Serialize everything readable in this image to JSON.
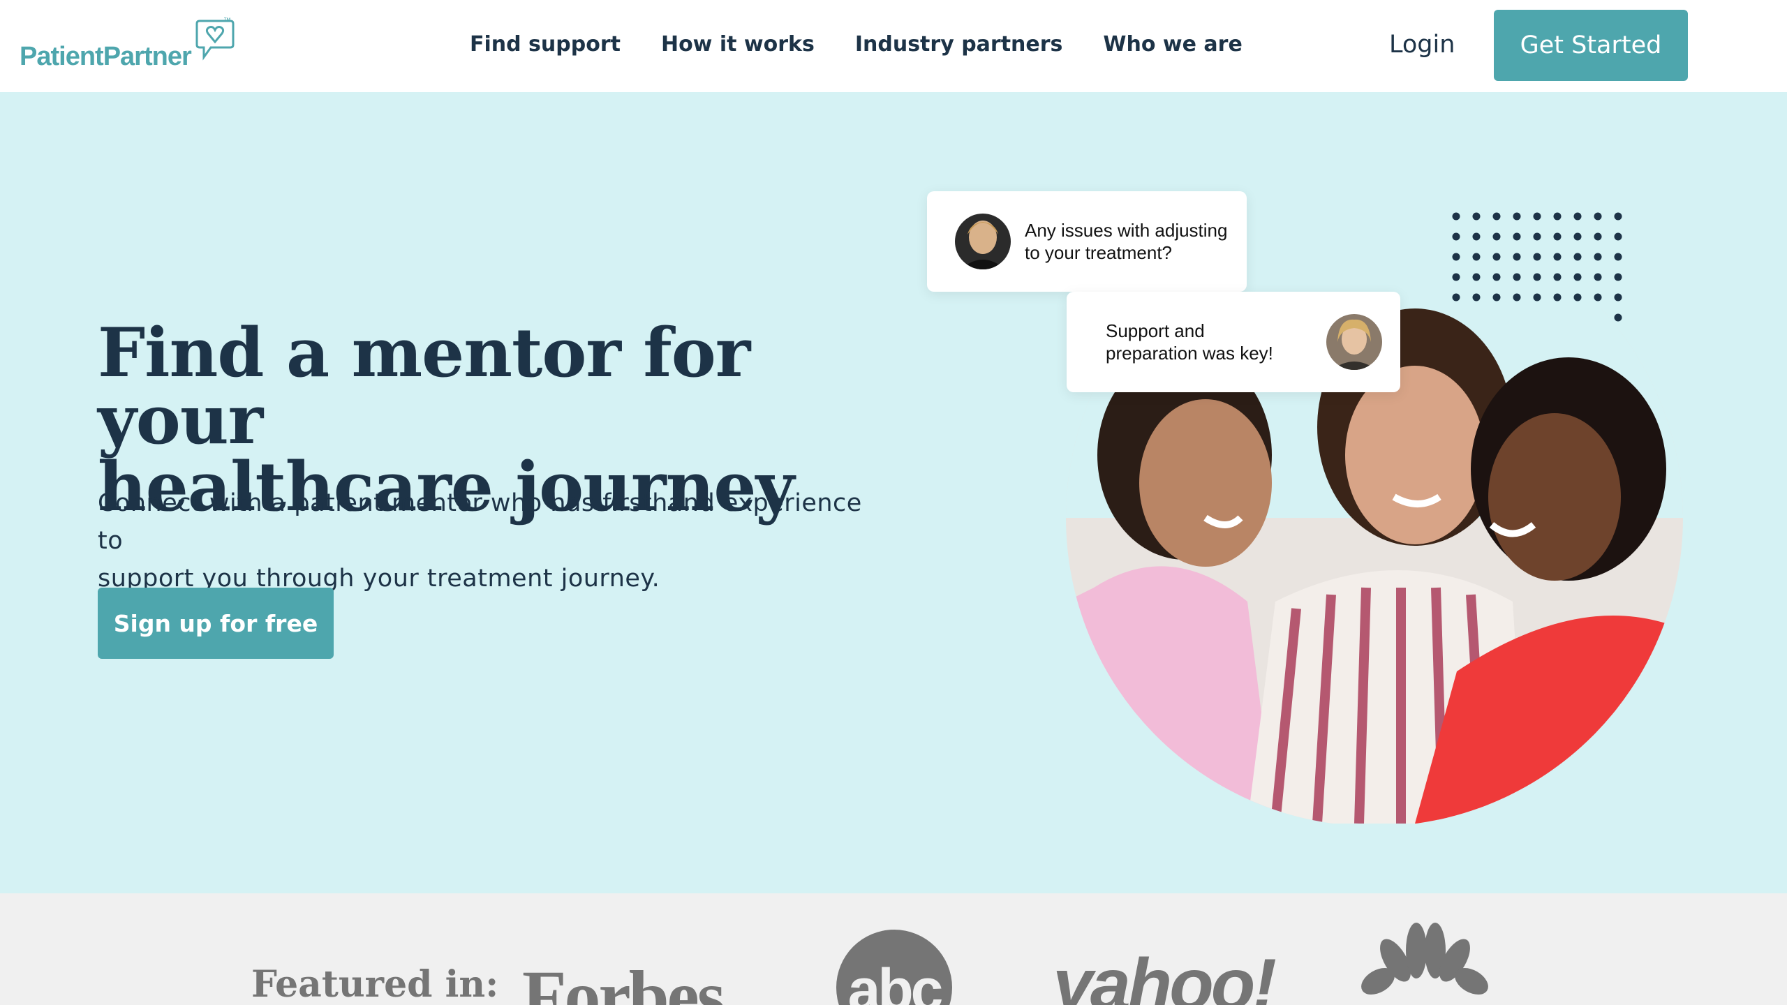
{
  "brand": {
    "name": "PatientPartner",
    "trademark": "™",
    "color": "#4ea6ad"
  },
  "nav": {
    "items": [
      {
        "label": "Find support"
      },
      {
        "label": "How it works"
      },
      {
        "label": "Industry partners"
      },
      {
        "label": "Who we are"
      }
    ],
    "login_label": "Login",
    "cta_label": "Get Started"
  },
  "hero": {
    "title_line1": "Find a mentor for your",
    "title_line2": "healthcare journey",
    "subtitle_line1": "Connect with a patient mentor who has firsthand experience to",
    "subtitle_line2": "support you through your treatment journey.",
    "cta_label": "Sign up for free",
    "background_color": "#d5f2f4",
    "chat_bubbles": [
      {
        "line1": "Any issues with adjusting",
        "line2": "to your treatment?"
      },
      {
        "line1": "Support and",
        "line2": "preparation was key!"
      }
    ]
  },
  "featured": {
    "label": "Featured in:",
    "logos": [
      {
        "name": "Forbes",
        "text": "Forbes"
      },
      {
        "name": "abc",
        "text": "abc"
      },
      {
        "name": "yahoo",
        "text": "yahoo!"
      },
      {
        "name": "nbc",
        "text": ""
      }
    ]
  },
  "colors": {
    "accent": "#4ea6ad",
    "navy": "#1d3347",
    "featured_bg": "#f0f0f0",
    "logo_grey": "#757575"
  }
}
